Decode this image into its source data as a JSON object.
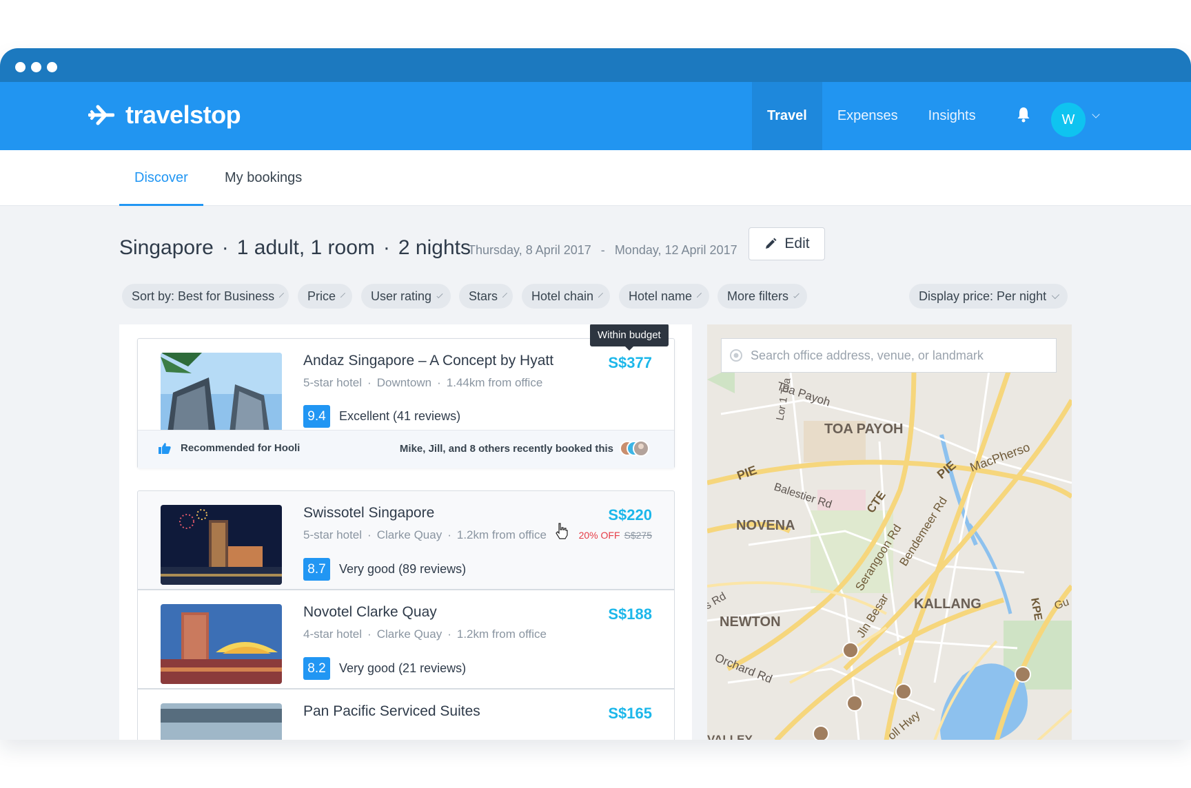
{
  "brand": {
    "name": "travelstop"
  },
  "nav": {
    "items": [
      {
        "label": "Travel",
        "active": true
      },
      {
        "label": "Expenses",
        "active": false
      },
      {
        "label": "Insights",
        "active": false
      }
    ],
    "avatar_initial": "W"
  },
  "subnav": {
    "tabs": [
      {
        "label": "Discover",
        "active": true
      },
      {
        "label": "My bookings",
        "active": false
      }
    ]
  },
  "search": {
    "city": "Singapore",
    "guests": "1 adult, 1 room",
    "nights": "2 nights",
    "separator": "·",
    "check_in": "Thursday, 8 April 2017",
    "date_separator": "-",
    "check_out": "Monday, 12 April 2017",
    "edit_label": "Edit"
  },
  "filters": {
    "sort": "Sort by: Best for Business",
    "price": "Price",
    "user_rating": "User rating",
    "stars": "Stars",
    "hotel_chain": "Hotel chain",
    "hotel_name": "Hotel name",
    "more": "More filters",
    "display_price": "Display price: Per night"
  },
  "hotels": [
    {
      "name": "Andaz Singapore – A Concept by Hyatt",
      "stars": "5-star hotel",
      "area": "Downtown",
      "distance": "1.44km from office",
      "score": "9.4",
      "review": "Excellent (41 reviews)",
      "price": "S$377",
      "tooltip": "Within budget",
      "recommendation": "Recommended for Hooli",
      "social": "Mike, Jill, and 8 others recently booked this"
    },
    {
      "name": "Swissotel Singapore",
      "stars": "5-star hotel",
      "area": "Clarke Quay",
      "distance": "1.2km from office",
      "score": "8.7",
      "review": "Very good (89 reviews)",
      "price": "S$220",
      "discount": "20% OFF",
      "old_price": "S$275"
    },
    {
      "name": "Novotel Clarke Quay",
      "stars": "4-star hotel",
      "area": "Clarke Quay",
      "distance": "1.2km from office",
      "score": "8.2",
      "review": "Very good (21 reviews)",
      "price": "S$188"
    },
    {
      "name": "Pan Pacific Serviced Suites",
      "price": "S$165"
    }
  ],
  "map": {
    "search_placeholder": "Search office address, venue, or landmark",
    "labels": [
      "Toa Payoh",
      "TOA PAYOH",
      "Lor 1 Toa",
      "PIE",
      "Balestier Rd",
      "NOVENA",
      "CTE",
      "PIE",
      "MacPherso",
      "Serangoon Rd",
      "Bendemeer Rd",
      "s Rd",
      "NEWTON",
      "Jln Besar",
      "KALLANG",
      "KPE",
      "Gu",
      "Orchard Rd",
      "oll Hwy",
      "VALLEY"
    ]
  },
  "colors": {
    "primary": "#2195f1",
    "chrome": "#1c79bf",
    "price": "#1cb7ea",
    "score": "#2196f3",
    "discount": "#e53b45"
  }
}
